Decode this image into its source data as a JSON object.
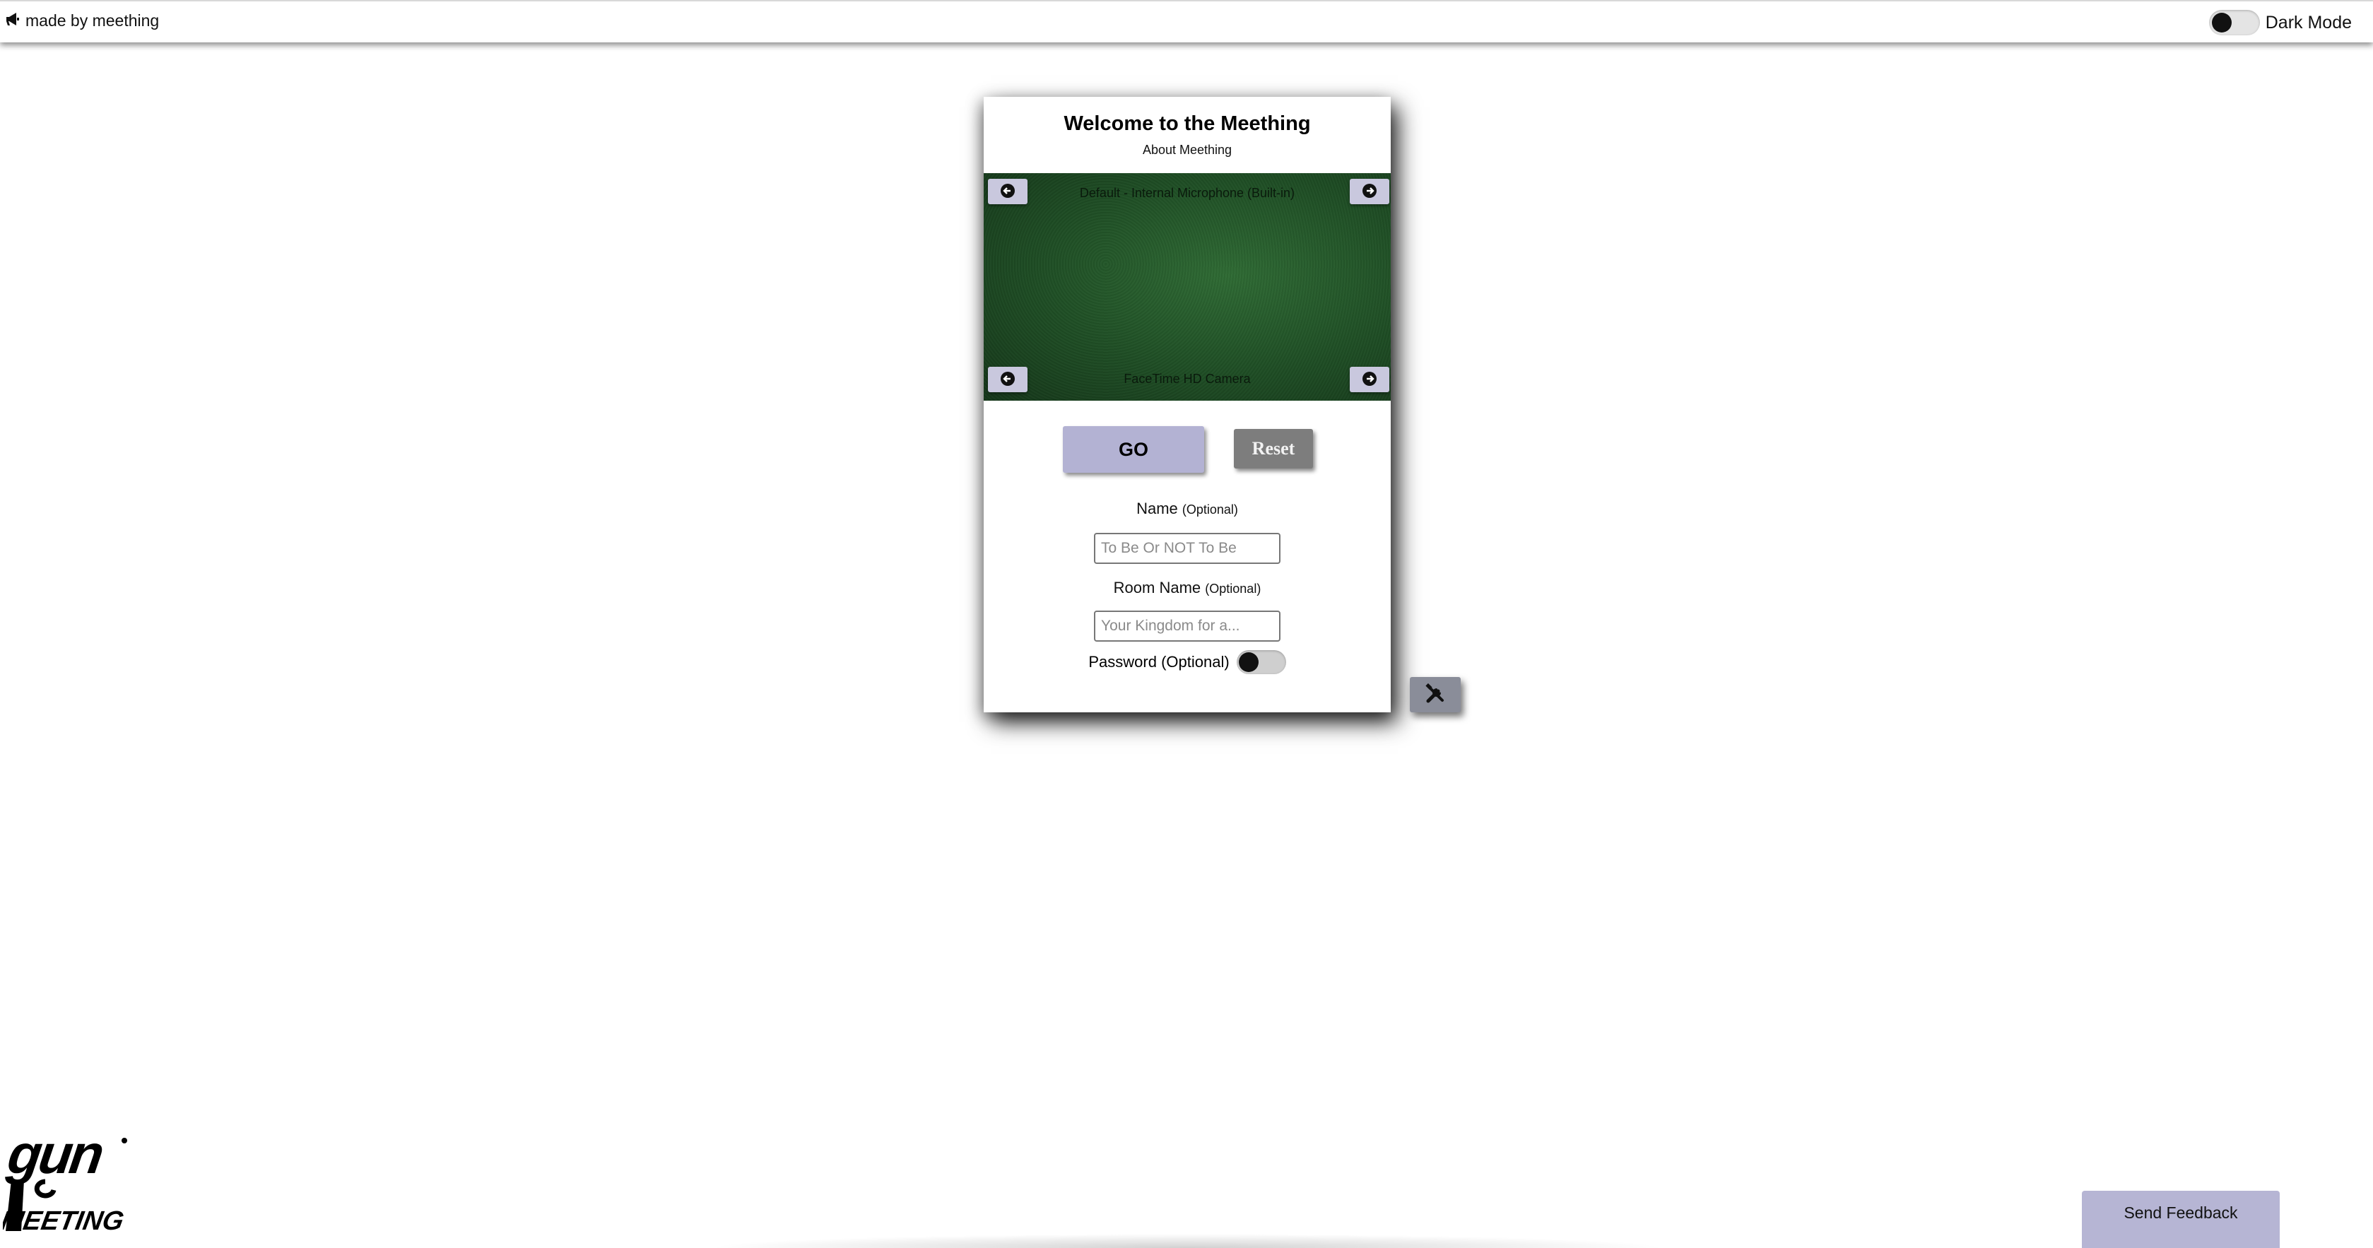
{
  "topbar": {
    "made_by_label": "made by meething",
    "made_by_icon": "megaphone-icon",
    "dark_mode_label": "Dark Mode",
    "dark_mode_on": false
  },
  "card": {
    "title": "Welcome to the Meething",
    "about_link": "About Meething",
    "preview": {
      "microphone_label": "Default - Internal Microphone (Built-in)",
      "camera_label": "FaceTime HD Camera",
      "prev_icon": "arrow-left-circle-icon",
      "next_icon": "arrow-right-circle-icon"
    },
    "go_label": "GO",
    "reset_label": "Reset",
    "name": {
      "label": "Name",
      "optional": "(Optional)",
      "placeholder": "To Be Or NOT To Be"
    },
    "room": {
      "label": "Room Name",
      "optional": "(Optional)",
      "placeholder": "Your Kingdom for a..."
    },
    "password": {
      "label": "Password",
      "optional": "(Optional)",
      "enabled": false
    }
  },
  "tools_icon": "tools-icon",
  "logo": {
    "text_top": "gun",
    "text_bottom": "MEETING"
  },
  "feedback_label": "Send Feedback",
  "colors": {
    "button_lavender": "#b3b2d3",
    "reset_gray": "#7d7d7d",
    "preview_green": "#1f4e25",
    "tools_gray": "#8a8d99"
  }
}
